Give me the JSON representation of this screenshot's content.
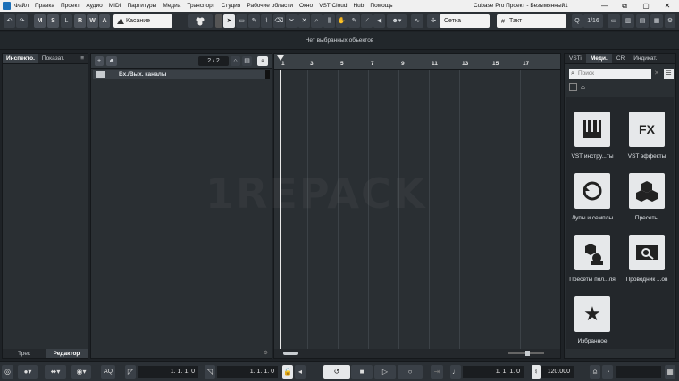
{
  "menubar": {
    "items": [
      "Файл",
      "Правка",
      "Проект",
      "Аудио",
      "MIDI",
      "Партитуры",
      "Медиа",
      "Транспорт",
      "Студия",
      "Рабочие области",
      "Окно",
      "VST Cloud",
      "Hub",
      "Помощь"
    ],
    "title": "Cubase Pro Проект - Безымянный1",
    "min": "—",
    "max": "▢",
    "close": "✕",
    "restore": "⧉"
  },
  "toolbar": {
    "undo": "↶",
    "redo": "↷",
    "m": "M",
    "s": "S",
    "l": "L",
    "r": "R",
    "w": "W",
    "a": "A",
    "automation_mode": "Касание",
    "snap_type": "Сетка",
    "grid": "Такт",
    "quantize": "1/16"
  },
  "infoline": {
    "text": "Нет выбранных объектов"
  },
  "inspector": {
    "tab1": "Инспекто.",
    "tab2": "Показат.",
    "bottom_tab1": "Трек",
    "bottom_tab2": "Редактор"
  },
  "tracklist": {
    "counter": "2 / 2",
    "track_name": "Вх./Вых. каналы"
  },
  "ruler": {
    "bars": [
      "1",
      "3",
      "5",
      "7",
      "9",
      "11",
      "13",
      "15",
      "17"
    ]
  },
  "media": {
    "tabs": [
      "VSTi",
      "Меди.",
      "CR",
      "Индикат."
    ],
    "search_placeholder": "Поиск",
    "tiles": [
      {
        "label": "VST инстру...ты",
        "icon": "piano-icon"
      },
      {
        "label": "VST эффекты",
        "icon": "fx-icon"
      },
      {
        "label": "Лупы и семплы",
        "icon": "loop-icon"
      },
      {
        "label": "Пресеты",
        "icon": "presets-icon"
      },
      {
        "label": "Пресеты пол...ля",
        "icon": "user-presets-icon"
      },
      {
        "label": "Проводник ...ов",
        "icon": "file-browser-icon"
      },
      {
        "label": "Избранное",
        "icon": "star-icon"
      }
    ]
  },
  "transport": {
    "left_locator": "1. 1. 1. 0",
    "right_locator": "1. 1. 1. 0",
    "position": "1. 1. 1. 0",
    "tempo": "120.000",
    "aq": "AQ"
  },
  "watermark": "1REPACK"
}
